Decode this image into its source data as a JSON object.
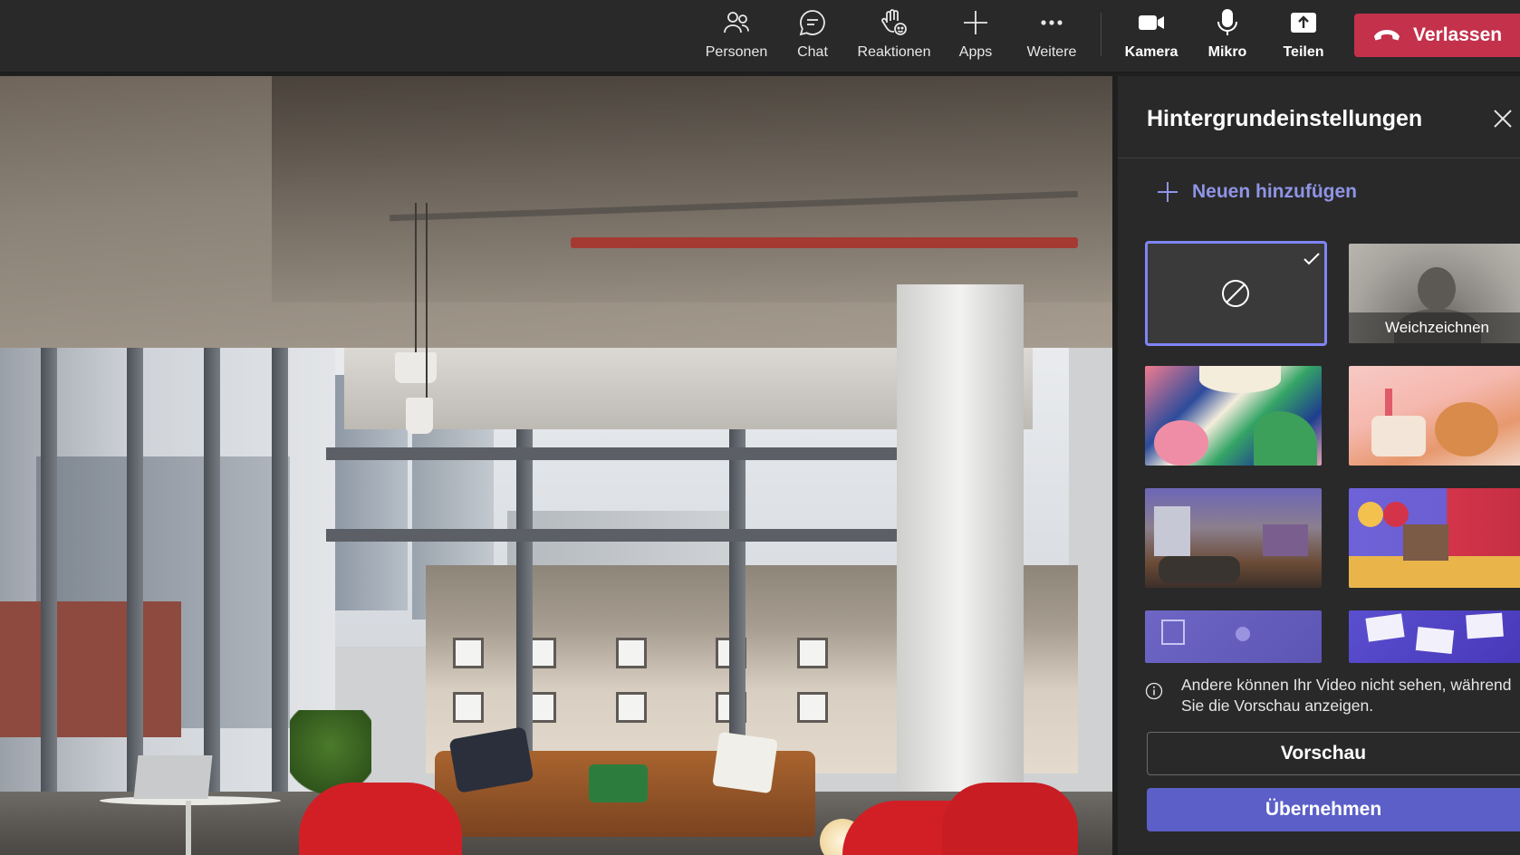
{
  "toolbar": {
    "people_label": "Personen",
    "chat_label": "Chat",
    "reactions_label": "Reaktionen",
    "apps_label": "Apps",
    "more_label": "Weitere",
    "camera_label": "Kamera",
    "mic_label": "Mikro",
    "share_label": "Teilen",
    "leave_label": "Verlassen"
  },
  "panel": {
    "title": "Hintergrundeinstellungen",
    "add_new_label": "Neuen hinzufügen",
    "blur_label": "Weichzeichnen",
    "info_text": "Andere können Ihr Video nicht sehen, während Sie die Vorschau anzeigen.",
    "preview_label": "Vorschau",
    "apply_label": "Übernehmen",
    "selected_option": "none"
  },
  "colors": {
    "accent": "#5b5fc7",
    "accent_light": "#8f94e6",
    "leave_red": "#c4314b",
    "bar_bg": "#292929"
  },
  "icons": {
    "people": "people-icon",
    "chat": "chat-icon",
    "reactions": "raised-hand-icon",
    "apps": "plus-icon",
    "more": "more-icon",
    "camera": "video-camera-icon",
    "mic": "microphone-icon",
    "share": "share-screen-icon",
    "leave": "hang-up-icon",
    "close": "close-icon",
    "add": "plus-icon",
    "none": "no-background-icon",
    "selected": "checkmark-icon",
    "info": "info-icon"
  }
}
